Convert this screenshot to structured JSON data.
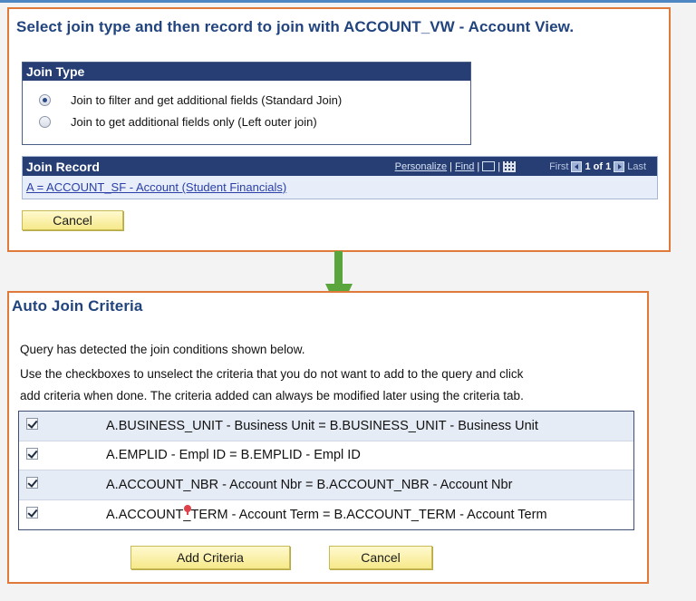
{
  "panel1": {
    "title": "Select join type and then record to join with ACCOUNT_VW - Account View.",
    "join_type": {
      "header": "Join Type",
      "options": [
        {
          "label": "Join to filter and get additional fields (Standard Join)",
          "selected": true
        },
        {
          "label": "Join to get additional fields only (Left outer join)",
          "selected": false
        }
      ]
    },
    "join_record": {
      "header": "Join Record",
      "personalize": "Personalize",
      "separator": "|",
      "find": "Find",
      "first": "First",
      "page_count": "1 of 1",
      "last": "Last",
      "row_link": "A = ACCOUNT_SF - Account (Student Financials)"
    },
    "cancel_label": "Cancel"
  },
  "panel2": {
    "title": "Auto Join Criteria",
    "desc_line1": "Query has detected the join conditions shown below.",
    "desc_line2": "Use the checkboxes to unselect the criteria that you do not want to add to the query and click",
    "desc_line3": "add criteria when done. The criteria added can always be modified later using the criteria tab.",
    "criteria": [
      {
        "checked": true,
        "text": "A.BUSINESS_UNIT - Business Unit = B.BUSINESS_UNIT - Business Unit"
      },
      {
        "checked": true,
        "text": "A.EMPLID - Empl ID = B.EMPLID - Empl ID"
      },
      {
        "checked": true,
        "text": "A.ACCOUNT_NBR - Account Nbr = B.ACCOUNT_NBR - Account Nbr"
      },
      {
        "checked": true,
        "text": "A.ACCOUNT_TERM - Account Term = B.ACCOUNT_TERM - Account Term"
      }
    ],
    "add_criteria_label": "Add Criteria",
    "cancel_label": "Cancel"
  },
  "colors": {
    "panel_border": "#e07a3a",
    "header_bg": "#263e73",
    "title_text": "#21447e",
    "arrow": "#5aa63c",
    "button_bg": "#f6e98a"
  }
}
